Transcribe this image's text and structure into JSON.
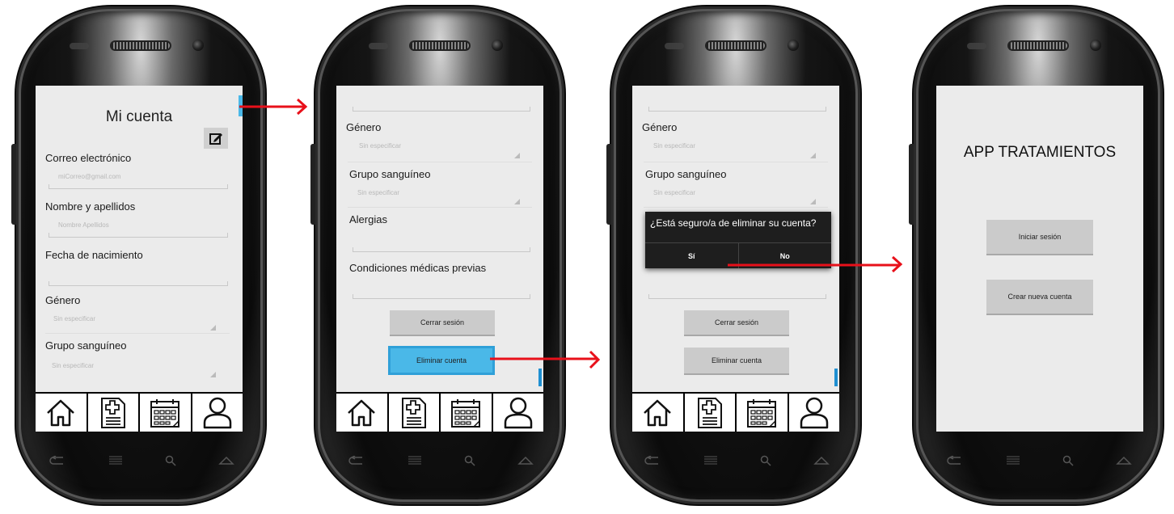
{
  "screen1": {
    "title": "Mi cuenta",
    "email_label": "Correo electrónico",
    "email_value": "miCorreo@gmail.com",
    "name_label": "Nombre y apellidos",
    "name_value": "Nombre Apellidos",
    "birth_label": "Fecha de nacimiento",
    "birth_value": "",
    "gender_label": "Género",
    "gender_value": "Sin especificar",
    "blood_label": "Grupo sanguíneo",
    "blood_value": "Sin especificar"
  },
  "screen2": {
    "gender_label": "Género",
    "gender_value": "Sin especificar",
    "blood_label": "Grupo sanguíneo",
    "blood_value": "Sin especificar",
    "allergies_label": "Alergias",
    "conditions_label": "Condiciones médicas previas",
    "logout_button": "Cerrar sesión",
    "delete_button": "Eliminar cuenta"
  },
  "screen3": {
    "gender_label": "Género",
    "gender_value": "Sin especificar",
    "blood_label": "Grupo sanguíneo",
    "blood_value": "Sin especificar",
    "dialog_title": "¿Está seguro/a de eliminar su cuenta?",
    "dialog_yes": "Sí",
    "dialog_no": "No",
    "logout_button": "Cerrar sesión",
    "delete_button": "Eliminar cuenta"
  },
  "screen4": {
    "app_title": "APP TRATAMIENTOS",
    "login_button": "Iniciar sesión",
    "register_button": "Crear nueva cuenta"
  },
  "nav": {
    "icons": [
      "home-icon",
      "medical-record-icon",
      "calendar-icon",
      "user-icon"
    ]
  },
  "colors": {
    "arrow": "#e8101a",
    "highlight": "#4ab8e8",
    "scrollbar": "#1f8fd1",
    "screen_bg": "#ebebeb",
    "button_bg": "#cbcbcb",
    "dialog_bg": "#1e1e1e"
  }
}
